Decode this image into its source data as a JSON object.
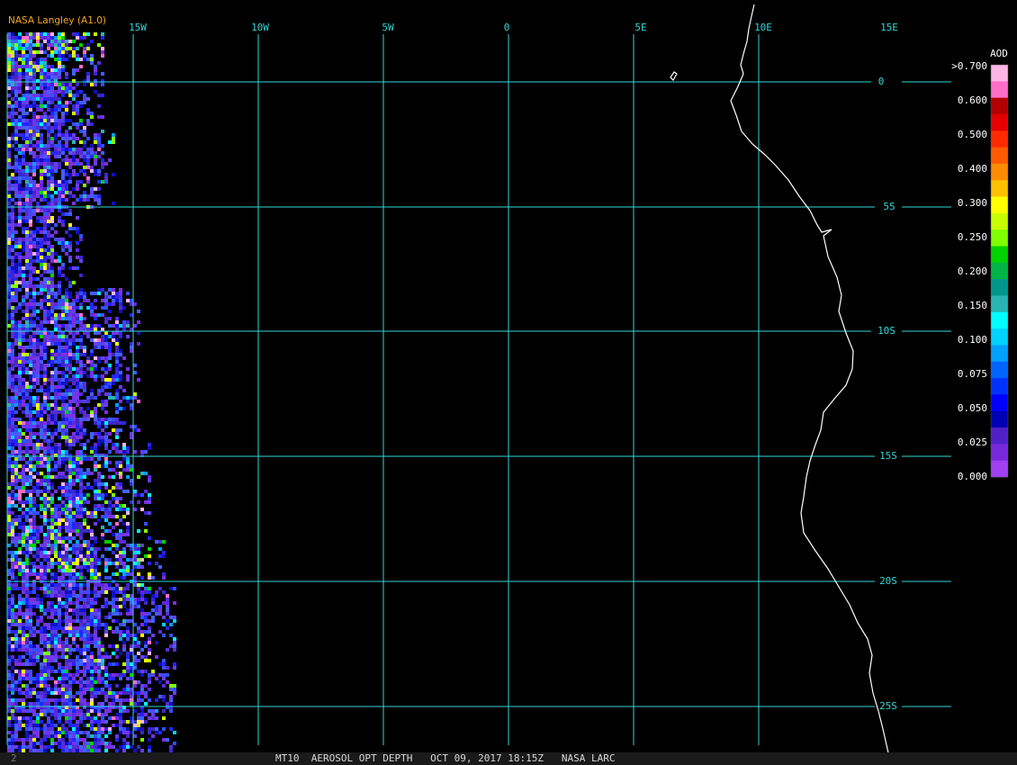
{
  "source_label": "NASA Langley (A1.0)",
  "product_title": "MT10  AEROSOL OPT DEPTH   OCT 09, 2017 18:15Z   NASA LARC",
  "frame_number": "2",
  "longitude_labels": [
    "15W",
    "10W",
    "5W",
    "0",
    "5E",
    "10E",
    "15E"
  ],
  "latitude_labels": [
    "0",
    "5S",
    "10S",
    "15S",
    "20S",
    "25S"
  ],
  "colorbar": {
    "title": "AOD",
    "tick_labels": [
      ">0.700",
      "0.600",
      "0.500",
      "0.400",
      "0.300",
      "0.250",
      "0.200",
      "0.150",
      "0.100",
      "0.075",
      "0.050",
      "0.025",
      "0.000"
    ],
    "colors_top_to_bottom": [
      "#ffb4e6",
      "#ff6ec7",
      "#b30000",
      "#e60000",
      "#ff2a00",
      "#ff5a00",
      "#ff8c00",
      "#ffc000",
      "#ffff00",
      "#c8ff00",
      "#7fff00",
      "#00d200",
      "#00b446",
      "#00968c",
      "#28b4b4",
      "#00ffff",
      "#00d2ff",
      "#00a0ff",
      "#0064ff",
      "#0032ff",
      "#0000ff",
      "#0000b4",
      "#5020c8",
      "#7828dc",
      "#a040f0"
    ]
  },
  "palette": {
    "grid": "#33d6d6",
    "coastline": "#ffffff",
    "source_label": "#f5a623"
  }
}
